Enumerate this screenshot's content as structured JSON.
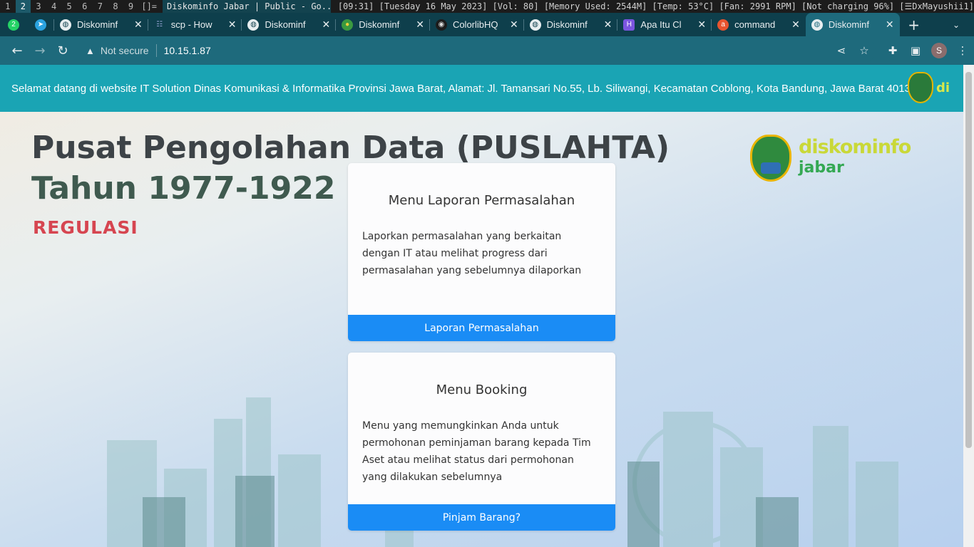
{
  "i3bar": {
    "workspaces": [
      "1",
      "2",
      "3",
      "4",
      "5",
      "6",
      "7",
      "8",
      "9"
    ],
    "layout_indicator": "[]=",
    "window_title": "Diskominfo Jabar | Public - Go...",
    "status": "[09:31] [Tuesday 16 May 2023] [Vol: 80] [Memory Used: 2544M] [Temp: 53°C] [Fan: 2991 RPM] [Not charging 96%] [☰DxMayushii1]"
  },
  "tabs": [
    {
      "label": "Diskominf",
      "icon": "globe-icon"
    },
    {
      "label": "scp - How",
      "icon": "stack-icon"
    },
    {
      "label": "Diskominf",
      "icon": "globe-icon"
    },
    {
      "label": "Diskominf",
      "icon": "seal-icon"
    },
    {
      "label": "ColorlibHQ",
      "icon": "github-icon"
    },
    {
      "label": "Diskominf",
      "icon": "globe-icon"
    },
    {
      "label": "Apa Itu Cl",
      "icon": "h-icon"
    },
    {
      "label": "command",
      "icon": "ask-icon"
    },
    {
      "label": "Diskominf",
      "icon": "globe-icon"
    }
  ],
  "pinned": [
    {
      "icon": "whatsapp-icon",
      "badge": "2"
    },
    {
      "icon": "telegram-icon"
    }
  ],
  "toolbar": {
    "security_label": "Not secure",
    "url": "10.15.1.87",
    "profile_initial": "S"
  },
  "page": {
    "ticker": "Selamat datang di website IT Solution Dinas Komunikasi & Informatika Provinsi Jawa Barat, Alamat: Jl. Tamansari No.55, Lb. Siliwangi, Kecamatan Coblong, Kota Bandung, Jawa Barat 40132",
    "ticker_brand": "di",
    "hero_title": "Pusat Pengolahan Data (PUSLAHTA)",
    "hero_subtitle": "Tahun 1977-1922",
    "regulasi": "REGULASI",
    "brand_top": "diskominfo",
    "brand_bottom": "jabar",
    "cards": [
      {
        "title": "Menu Laporan Permasalahan",
        "body": "Laporkan permasalahan yang berkaitan dengan IT atau melihat progress dari permasalahan yang sebelumnya dilaporkan",
        "button": "Laporan Permasalahan"
      },
      {
        "title": "Menu Booking",
        "body": "Menu yang memungkinkan Anda untuk permohonan peminjaman barang kepada Tim Aset atau melihat status dari permohonan yang dilakukan sebelumnya",
        "button": "Pinjam Barang?"
      }
    ]
  },
  "colors": {
    "accent": "#1a8cf5",
    "ticker_bg": "#1aa4b4",
    "browser_frame": "#1e6a7c",
    "regulasi": "#d64550"
  }
}
